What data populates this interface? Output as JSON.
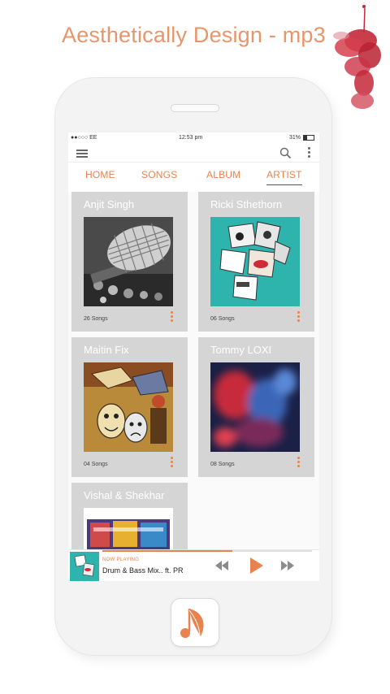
{
  "headline": "Aesthetically Design - mp3",
  "status_bar": {
    "carrier": "●●○○○ EE",
    "time": "12:53 pm",
    "battery": "31%"
  },
  "toolbar": {
    "menu_icon": "hamburger-menu-icon",
    "search_icon": "search-icon",
    "more_icon": "vertical-dots-icon"
  },
  "tabs": [
    {
      "label": "HOME",
      "active": false
    },
    {
      "label": "SONGS",
      "active": false
    },
    {
      "label": "ALBUM",
      "active": false
    },
    {
      "label": "ARTIST",
      "active": true
    }
  ],
  "artists": [
    {
      "name": "Anjit Singh",
      "count": "26 Songs",
      "art": "microphone"
    },
    {
      "name": "Ricki Sthethorn",
      "count": "06 Songs",
      "art": "teal-collage"
    },
    {
      "name": "Maitin Fix",
      "count": "04 Songs",
      "art": "masks-painting"
    },
    {
      "name": "Tommy LOXI",
      "count": "08 Songs",
      "art": "blurred-portrait"
    },
    {
      "name": "Vishal & Shekhar",
      "count": "",
      "art": "colorful-poster"
    }
  ],
  "player": {
    "label": "NOW PLAYING",
    "track": "Drum & Bass Mix.. ft. PR",
    "progress": 0.62
  },
  "colors": {
    "accent": "#e8834f",
    "card": "#d5d5d5",
    "teal": "#2fb4ad"
  }
}
